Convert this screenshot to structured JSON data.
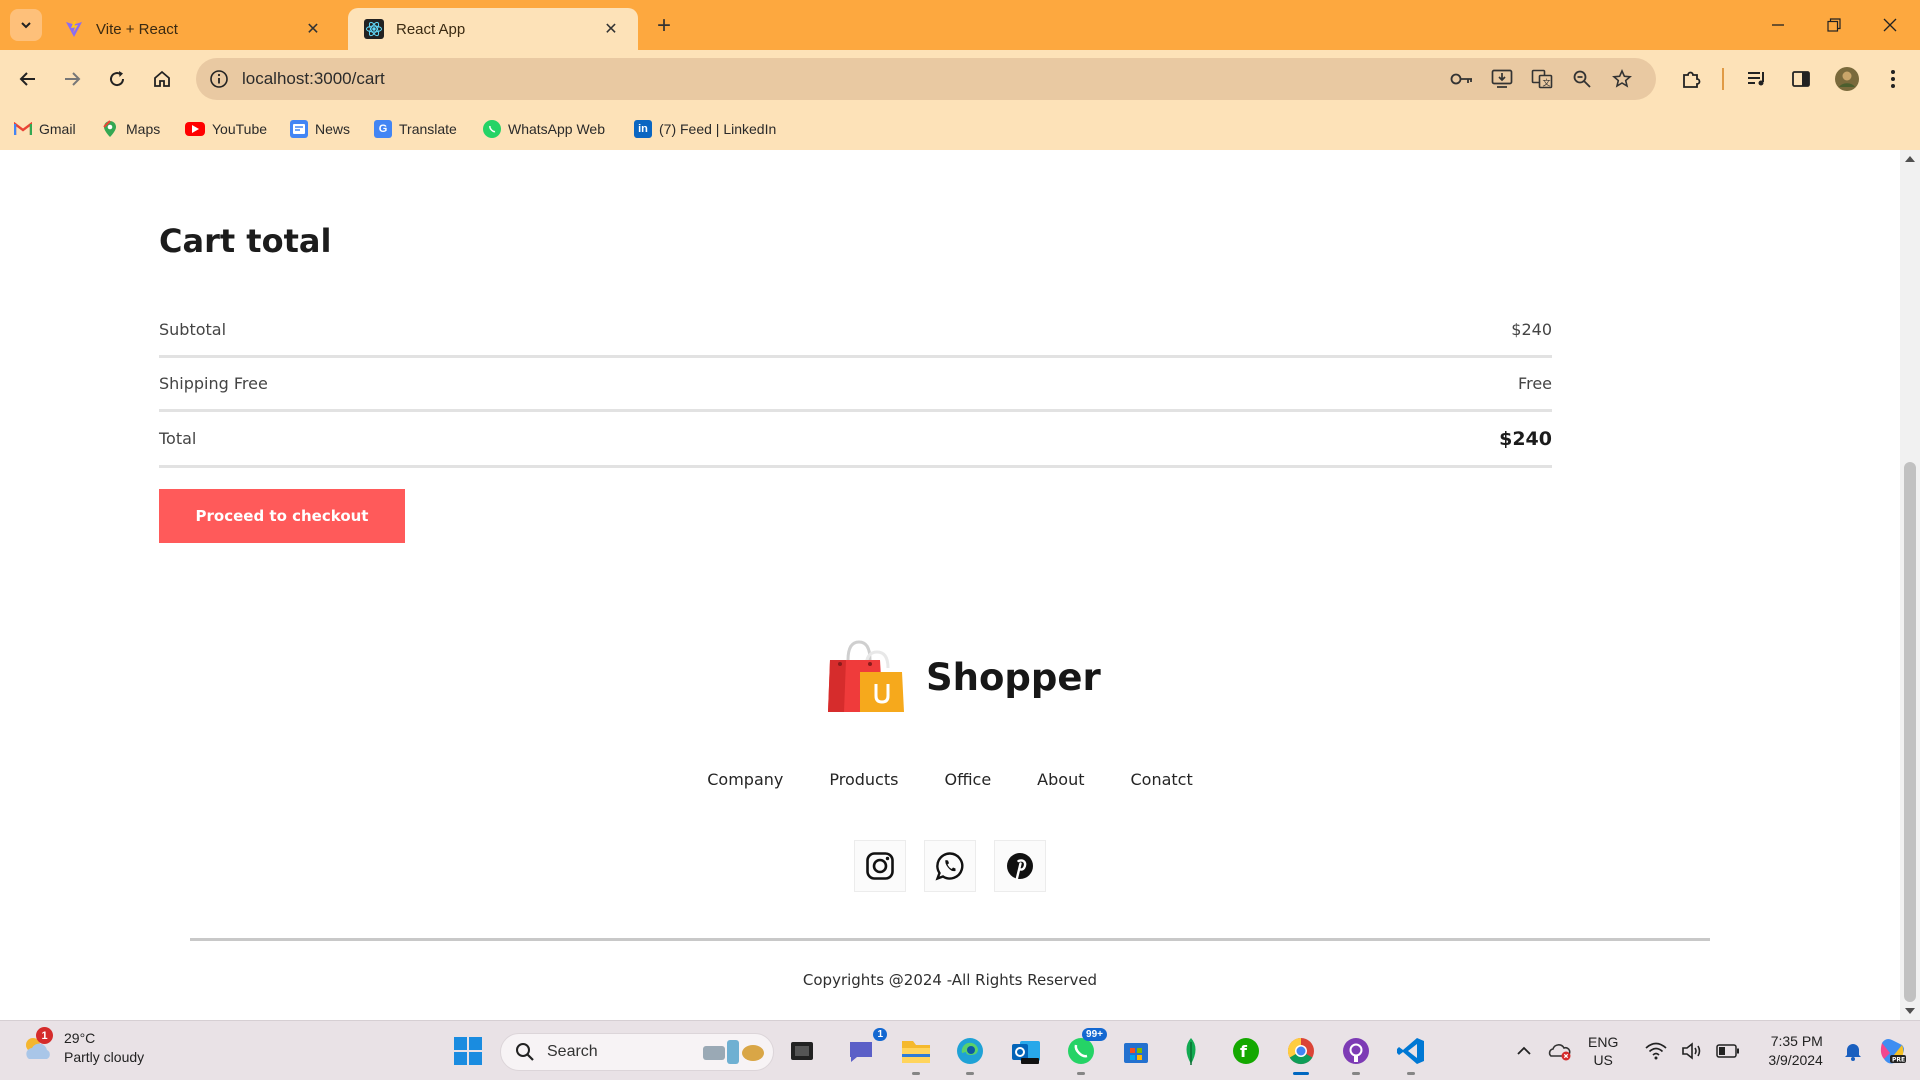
{
  "browser": {
    "tabs": [
      {
        "title": "Vite + React",
        "active": false,
        "icon": "vite-icon"
      },
      {
        "title": "React App",
        "active": true,
        "icon": "react-icon"
      }
    ],
    "address": "localhost:3000/cart",
    "bookmarks": [
      {
        "label": "Gmail",
        "icon": "gmail-icon",
        "color": "#ea4335"
      },
      {
        "label": "Maps",
        "icon": "maps-icon",
        "color": "#34a853"
      },
      {
        "label": "YouTube",
        "icon": "youtube-icon",
        "color": "#ff0000"
      },
      {
        "label": "News",
        "icon": "news-icon",
        "color": "#4285f4"
      },
      {
        "label": "Translate",
        "icon": "translate-icon",
        "color": "#4285f4"
      },
      {
        "label": "WhatsApp Web",
        "icon": "whatsapp-icon",
        "color": "#25d366"
      },
      {
        "label": "(7) Feed | LinkedIn",
        "icon": "linkedin-icon",
        "color": "#0a66c2"
      }
    ]
  },
  "cart": {
    "title": "Cart total",
    "rows": [
      {
        "label": "Subtotal",
        "value": "$240"
      },
      {
        "label": "Shipping Free",
        "value": "Free"
      },
      {
        "label": "Total",
        "value": "$240"
      }
    ],
    "checkout_label": "Proceed to checkout",
    "accent": "#ff5a5a"
  },
  "footer": {
    "brand": "Shopper",
    "links": [
      "Company",
      "Products",
      "Office",
      "About",
      "Conatct"
    ],
    "social": [
      "instagram-icon",
      "whatsapp-icon",
      "pinterest-icon"
    ],
    "copyright": "Copyrights @2024 -All Rights Reserved"
  },
  "taskbar": {
    "weather_temp": "29°C",
    "weather_desc": "Partly cloudy",
    "weather_badge": "1",
    "search_placeholder": "Search",
    "teams_badge": "1",
    "whatsapp_badge": "99+",
    "lang_top": "ENG",
    "lang_bottom": "US",
    "time": "7:35 PM",
    "date": "3/9/2024"
  },
  "colors": {
    "tabbar": "#fda83f",
    "toolbar": "#fde2b8",
    "omnibox": "#e9c9a2",
    "taskbar": "#e9e2e6"
  }
}
